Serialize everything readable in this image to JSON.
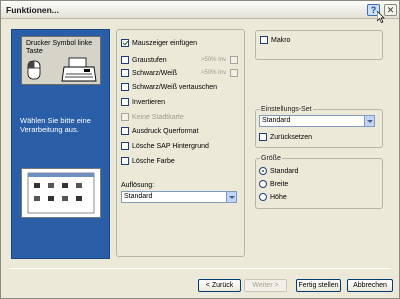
{
  "window": {
    "title": "Funktionen..."
  },
  "titlebar": {
    "help_glyph": "?",
    "close_glyph": "✕"
  },
  "sidebar": {
    "symbol_label": "Drucker Symbol linke Taste",
    "description": "Wählen Sie bitte eine Verarbeitung aus."
  },
  "options": {
    "mauszeiger": {
      "label": "Mauszeiger einfügen",
      "checked": true
    },
    "graustufen": {
      "label": "Graustufen",
      "pct": ">50% Inv",
      "checked": false
    },
    "schwarzweiss": {
      "label": "Schwarz/Weiß",
      "pct": ">50% Inv",
      "checked": false
    },
    "sw_vertauschen": {
      "label": "Schwarz/Weiß vertauschen",
      "checked": false
    },
    "invertieren": {
      "label": "Invertieren",
      "checked": false
    },
    "keine_stadtkarte": {
      "label": "Keine Stadtkarte",
      "checked": false,
      "disabled": true
    },
    "querformat": {
      "label": "Ausdruck Querformat",
      "checked": false
    },
    "sap_hintergrund": {
      "label": "Lösche SAP Hintergrund",
      "checked": false
    },
    "farbe": {
      "label": "Lösche Farbe",
      "checked": false
    }
  },
  "aufloesung": {
    "label": "Auflösung:",
    "value": "Standard"
  },
  "makro": {
    "label": "Makro",
    "checked": false
  },
  "einstellungs_set": {
    "legend": "Einstellungs-Set",
    "value": "Standard",
    "reset_label": "Zurücksetzen"
  },
  "groesse": {
    "legend": "Größe",
    "options": [
      {
        "label": "Standard",
        "checked": true
      },
      {
        "label": "Breite",
        "checked": false
      },
      {
        "label": "Höhe",
        "checked": false
      }
    ]
  },
  "buttons": {
    "back": "< Zurück",
    "next": "Weiter >",
    "finish": "Fertig stellen",
    "cancel": "Abbrechen"
  },
  "colors": {
    "sidebar": "#2a5fa8",
    "dialog": "#ece9d8",
    "accent_border": "#003c74"
  },
  "icons": [
    "help-icon",
    "close-icon",
    "mouse-icon",
    "printer-icon",
    "dropdown-arrow-icon"
  ]
}
